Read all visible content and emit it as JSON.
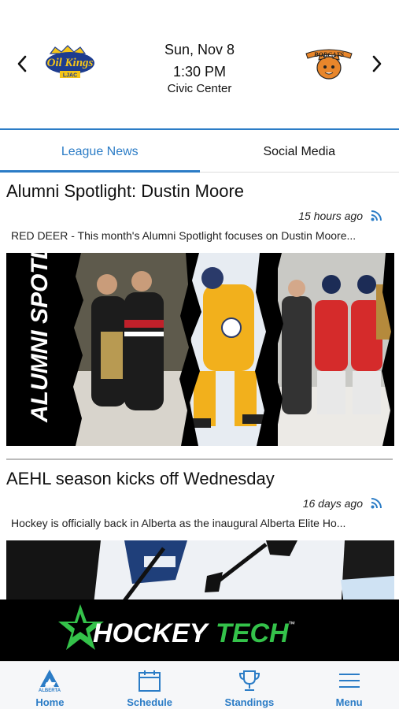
{
  "game": {
    "date": "Sun, Nov 8",
    "time": "1:30 PM",
    "venue": "Civic Center",
    "home_logo_text": "Oil Kings",
    "home_logo_subtext": "LJAC",
    "away_logo_text": "BOBCATS"
  },
  "tabs": [
    {
      "label": "League News",
      "active": true
    },
    {
      "label": "Social Media",
      "active": false
    }
  ],
  "articles": [
    {
      "title": "Alumni Spotlight: Dustin Moore",
      "age": "15 hours ago",
      "summary": "RED DEER - This month's Alumni Spotlight focuses on Dustin Moore...",
      "image_overlay_text": "ALUMNI SPOTLIGHT"
    },
    {
      "title": "AEHL season kicks off Wednesday",
      "age": "16 days ago",
      "summary": "Hockey is officially back in Alberta as the inaugural Alberta Elite Ho..."
    }
  ],
  "banner": {
    "brand_first": "HOCKEY",
    "brand_second": "TECH",
    "brand_mark": "™"
  },
  "bottom_nav": [
    {
      "label": "Home",
      "icon": "alberta-logo-icon",
      "logo_text": "ALBERTA"
    },
    {
      "label": "Schedule",
      "icon": "calendar-icon"
    },
    {
      "label": "Standings",
      "icon": "trophy-icon"
    },
    {
      "label": "Menu",
      "icon": "hamburger-menu-icon"
    }
  ],
  "colors": {
    "accent": "#2b7cc6",
    "brand_green": "#34c24a",
    "banner_bg": "#000000"
  }
}
